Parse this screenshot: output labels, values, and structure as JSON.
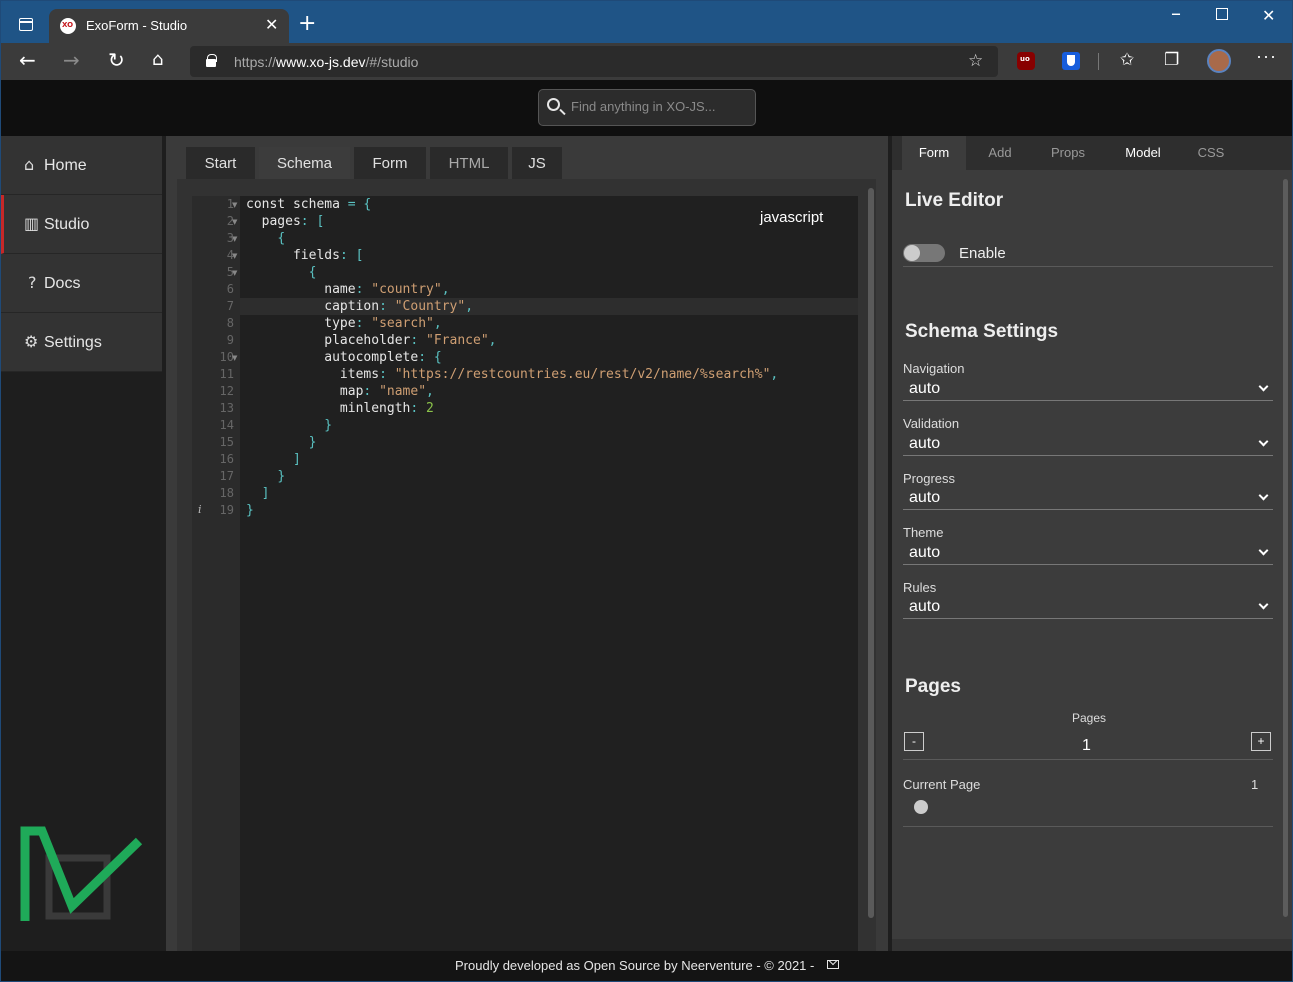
{
  "browser": {
    "tab_title": "ExoForm - Studio",
    "url_prefix": "https://",
    "url_domain": "www.xo-js.dev",
    "url_path": "/#/studio"
  },
  "header": {
    "search_placeholder": "Find anything in XO-JS..."
  },
  "sidebar": {
    "items": [
      {
        "label": "Home",
        "icon": "home-icon"
      },
      {
        "label": "Studio",
        "icon": "sliders-icon"
      },
      {
        "label": "Docs",
        "icon": "question-icon"
      },
      {
        "label": "Settings",
        "icon": "gear-icon"
      }
    ],
    "active": "Studio"
  },
  "center": {
    "tabs": [
      "Start",
      "Schema",
      "Form",
      "HTML",
      "JS"
    ],
    "active_tab": "Schema",
    "language": "javascript",
    "line_numbers": [
      "1",
      "2",
      "3",
      "4",
      "5",
      "6",
      "7",
      "8",
      "9",
      "10",
      "11",
      "12",
      "13",
      "14",
      "15",
      "16",
      "17",
      "18",
      "19"
    ]
  },
  "right": {
    "tabs": [
      "Form",
      "Add",
      "Props",
      "Model",
      "CSS"
    ],
    "active_tab": "Form",
    "live_editor_title": "Live Editor",
    "enable_label": "Enable",
    "enable_value": false,
    "schema_settings_title": "Schema Settings",
    "settings": [
      {
        "label": "Navigation",
        "value": "auto"
      },
      {
        "label": "Validation",
        "value": "auto"
      },
      {
        "label": "Progress",
        "value": "auto"
      },
      {
        "label": "Theme",
        "value": "auto"
      },
      {
        "label": "Rules",
        "value": "auto"
      }
    ],
    "pages_title": "Pages",
    "pages_label": "Pages",
    "pages_value": "1",
    "minus_label": "-",
    "plus_label": "+",
    "current_page_label": "Current Page",
    "current_page_value": "1"
  },
  "footer": {
    "text": "Proudly developed as Open Source by Neerventure - © 2021 -"
  },
  "colors": {
    "titlebar": "#1f5486",
    "active_accent": "#c62828",
    "logo_green": "#1faa59"
  }
}
